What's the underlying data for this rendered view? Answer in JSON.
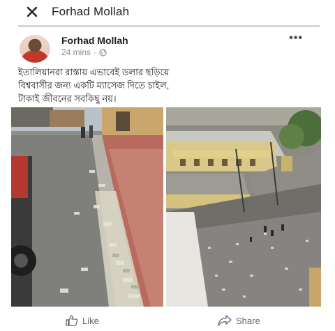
{
  "topbar": {
    "title": "Forhad Mollah"
  },
  "post": {
    "author": "Forhad Mollah",
    "time": "24 mins",
    "text": "ইতালিয়ানরা রাস্তায় এভাবেই ডলার ছড়িয়ে\nবিশ্ববাসীর জন্য একটি ম্যাসেজ দিতে চাইল,\nটাকাই জীবনের সবকিছু নয়।"
  },
  "actions": {
    "like": "Like",
    "share": "Share"
  }
}
